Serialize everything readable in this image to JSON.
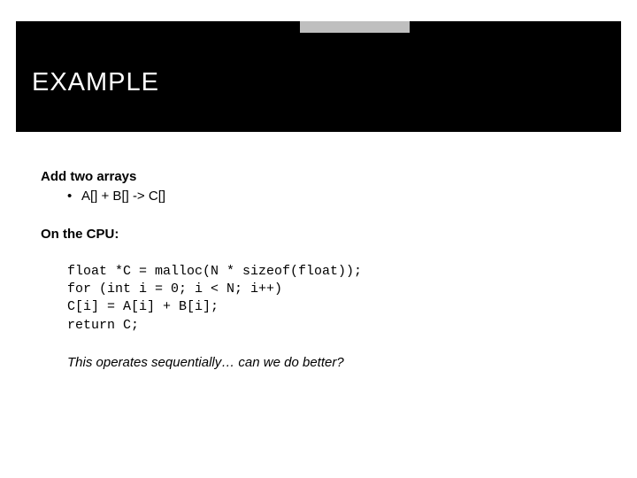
{
  "title": "EXAMPLE",
  "content": {
    "heading1": "Add two arrays",
    "bullet1": "A[] + B[] -> C[]",
    "heading2": "On the CPU:",
    "code": "float *C = malloc(N * sizeof(float));\nfor (int i = 0; i < N; i++)\nC[i] = A[i] + B[i];\nreturn C;",
    "closing": "This operates sequentially… can we do better?"
  }
}
